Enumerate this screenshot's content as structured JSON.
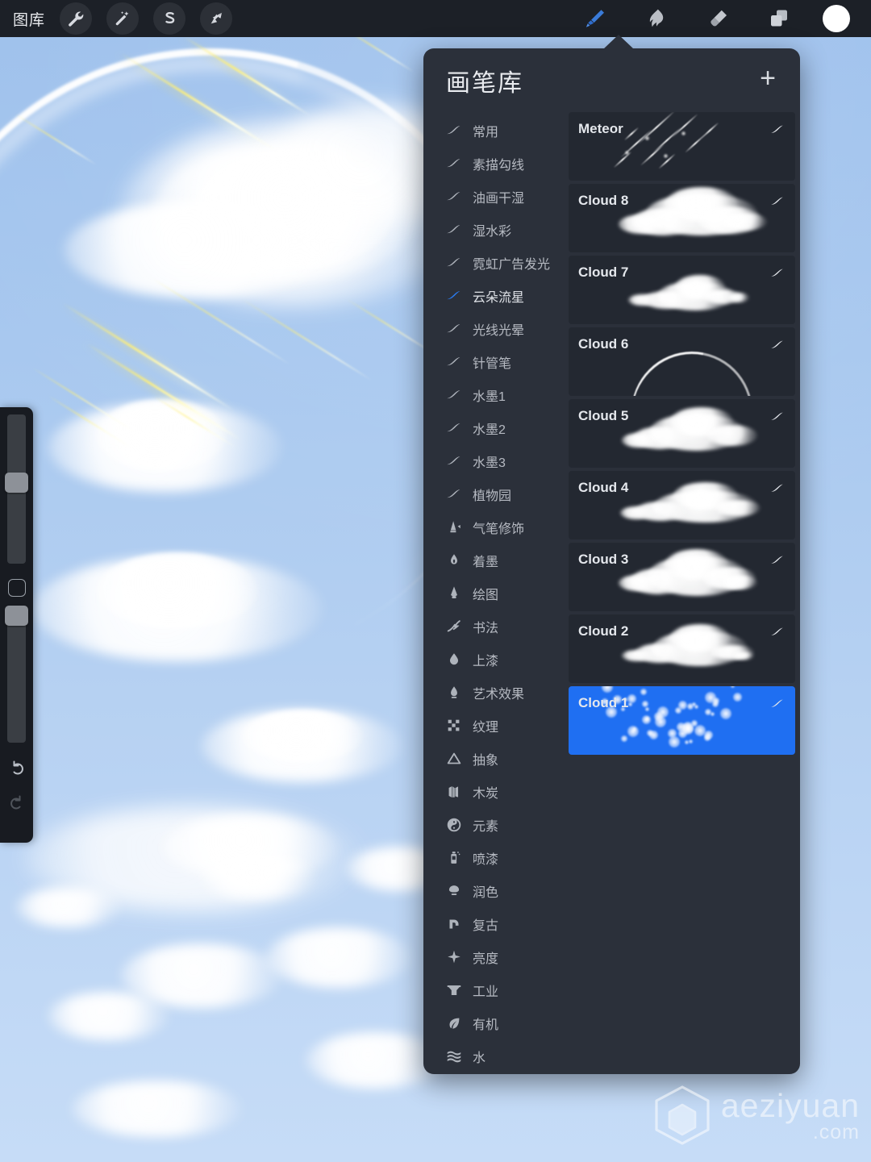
{
  "topbar": {
    "gallery_label": "图库",
    "left_tools": [
      {
        "name": "wrench-icon",
        "label": "调整"
      },
      {
        "name": "magic-wand-icon",
        "label": "调整"
      },
      {
        "name": "selection-s-icon",
        "label": "选取"
      },
      {
        "name": "arrow-transform-icon",
        "label": "变换变形"
      }
    ],
    "right_tools": [
      {
        "name": "brush-icon",
        "label": "绘图",
        "active": true
      },
      {
        "name": "smudge-icon",
        "label": "涂抹",
        "active": false
      },
      {
        "name": "eraser-icon",
        "label": "擦除",
        "active": false
      },
      {
        "name": "layers-icon",
        "label": "图层",
        "active": false
      }
    ],
    "color_swatch": "#ffffff"
  },
  "sidebar": {
    "size_slider": {
      "name": "brush-size-slider",
      "value_pct": 42
    },
    "modify_button": {
      "name": "modify-button"
    },
    "opacity_slider": {
      "name": "brush-opacity-slider",
      "value_pct": 97
    },
    "undo": {
      "name": "undo-button"
    },
    "redo": {
      "name": "redo-button"
    }
  },
  "brush_panel": {
    "title": "画笔库",
    "add_label": "+",
    "categories": [
      {
        "label": "常用",
        "icon": "stroke-icon",
        "selected": false
      },
      {
        "label": "素描勾线",
        "icon": "stroke-icon",
        "selected": false
      },
      {
        "label": "油画干湿",
        "icon": "stroke-icon",
        "selected": false
      },
      {
        "label": "湿水彩",
        "icon": "stroke-icon",
        "selected": false
      },
      {
        "label": "霓虹广告发光",
        "icon": "stroke-icon",
        "selected": false
      },
      {
        "label": "云朵流星",
        "icon": "stroke-icon",
        "selected": true
      },
      {
        "label": "光线光晕",
        "icon": "stroke-icon",
        "selected": false
      },
      {
        "label": "针管笔",
        "icon": "stroke-icon",
        "selected": false
      },
      {
        "label": "水墨1",
        "icon": "stroke-icon",
        "selected": false
      },
      {
        "label": "水墨2",
        "icon": "stroke-icon",
        "selected": false
      },
      {
        "label": "水墨3",
        "icon": "stroke-icon",
        "selected": false
      },
      {
        "label": "植物园",
        "icon": "stroke-icon",
        "selected": false
      },
      {
        "label": "气笔修饰",
        "icon": "airbrush-icon",
        "selected": false
      },
      {
        "label": "着墨",
        "icon": "ink-nib-icon",
        "selected": false
      },
      {
        "label": "绘图",
        "icon": "pencil-tip-icon",
        "selected": false
      },
      {
        "label": "书法",
        "icon": "calligraphy-icon",
        "selected": false
      },
      {
        "label": "上漆",
        "icon": "paint-drop-icon",
        "selected": false
      },
      {
        "label": "艺术效果",
        "icon": "art-flame-icon",
        "selected": false
      },
      {
        "label": "纹理",
        "icon": "texture-icon",
        "selected": false
      },
      {
        "label": "抽象",
        "icon": "triangle-icon",
        "selected": false
      },
      {
        "label": "木炭",
        "icon": "charcoal-icon",
        "selected": false
      },
      {
        "label": "元素",
        "icon": "yinyang-icon",
        "selected": false
      },
      {
        "label": "喷漆",
        "icon": "spraycan-icon",
        "selected": false
      },
      {
        "label": "润色",
        "icon": "retouch-icon",
        "selected": false
      },
      {
        "label": "复古",
        "icon": "vintage-icon",
        "selected": false
      },
      {
        "label": "亮度",
        "icon": "sparkle-icon",
        "selected": false
      },
      {
        "label": "工业",
        "icon": "industrial-icon",
        "selected": false
      },
      {
        "label": "有机",
        "icon": "leaf-icon",
        "selected": false
      },
      {
        "label": "水",
        "icon": "water-waves-icon",
        "selected": false
      }
    ],
    "brushes": [
      {
        "name": "Meteor",
        "preview": "meteor",
        "selected": false
      },
      {
        "name": "Cloud 8",
        "preview": "cloud-big",
        "selected": false
      },
      {
        "name": "Cloud 7",
        "preview": "cloud-low",
        "selected": false
      },
      {
        "name": "Cloud 6",
        "preview": "arc",
        "selected": false
      },
      {
        "name": "Cloud 5",
        "preview": "cloud-mid",
        "selected": false
      },
      {
        "name": "Cloud 4",
        "preview": "cloud-flat",
        "selected": false
      },
      {
        "name": "Cloud 3",
        "preview": "cloud-fluffy",
        "selected": false
      },
      {
        "name": "Cloud 2",
        "preview": "cloud-wispy",
        "selected": false
      },
      {
        "name": "Cloud 1",
        "preview": "dots",
        "selected": true
      }
    ],
    "selected_brush": "Cloud 1",
    "accent_color": "#1f6ff2",
    "panel_bg": "#2b303a"
  },
  "watermark": {
    "logo": "cube-logo-icon",
    "name": "aeziyuan",
    "domain": ".com"
  }
}
